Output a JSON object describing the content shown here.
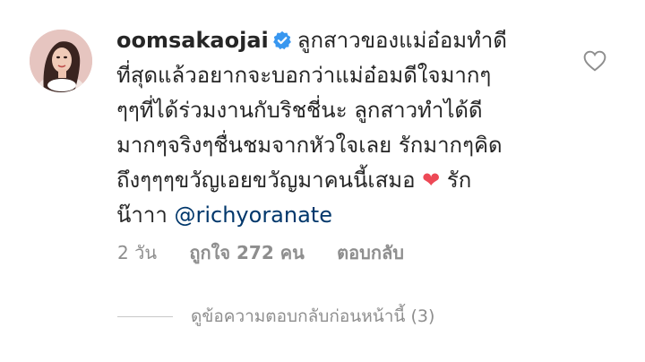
{
  "comment": {
    "username": "oomsakaojai",
    "lines": [
      "ลูกสาวของแม่อ๋อมทำดี",
      "ที่สุดแล้วอยากจะบอกว่าแม่อ๋อมดีใจมากๆ",
      "ๆๆที่ได้ร่วมงานกับริชชี่นะ ลูกสาวทำได้ดี",
      "มากๆจริงๆชื่นชมจากหัวใจเลย รักมากๆคิด",
      "ถึงๆๆๆขวัญเอยขวัญมาคนนี้เสมอ",
      "รัก",
      "น๊าาา",
      "@richyoranate"
    ],
    "heart_emoji": "❤"
  },
  "meta": {
    "time": "2 วัน",
    "likes": "ถูกใจ 272 คน",
    "reply": "ตอบกลับ"
  },
  "replies": {
    "label": "ดูข้อความตอบกลับก่อนหน้านี้ (3)"
  },
  "colors": {
    "verified": "#3897f0",
    "mention": "#00376b",
    "heart": "#ed4956"
  }
}
